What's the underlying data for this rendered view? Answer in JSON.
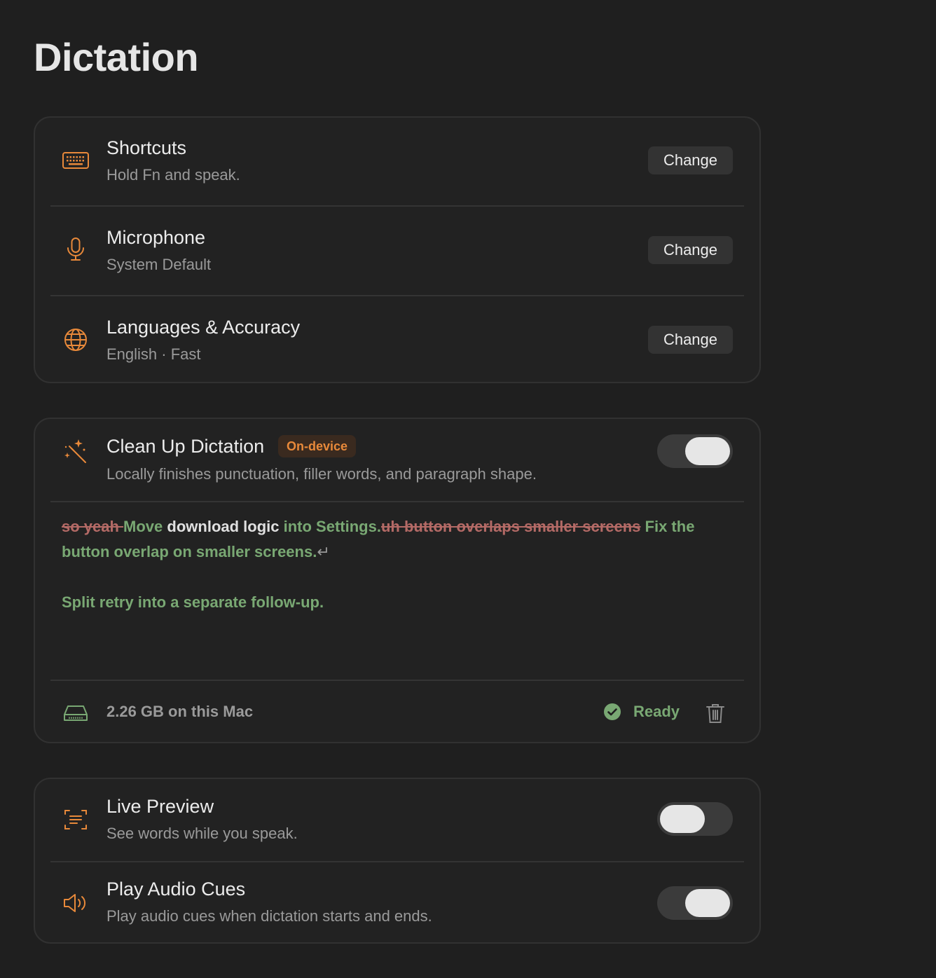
{
  "page": {
    "title": "Dictation"
  },
  "settings": {
    "shortcuts": {
      "title": "Shortcuts",
      "subtitle": "Hold Fn and speak.",
      "action": "Change",
      "icon": "keyboard-icon"
    },
    "microphone": {
      "title": "Microphone",
      "subtitle": "System Default",
      "action": "Change",
      "icon": "microphone-icon"
    },
    "languages": {
      "title": "Languages & Accuracy",
      "subtitle": "English · Fast",
      "action": "Change",
      "icon": "globe-icon"
    }
  },
  "cleanup": {
    "title": "Clean Up Dictation",
    "badge": "On-device",
    "subtitle": "Locally finishes punctuation, filler words, and paragraph shape.",
    "enabled": true,
    "icon": "magic-wand-icon",
    "preview": {
      "line1": [
        {
          "type": "deleted",
          "text": "so yeah "
        },
        {
          "type": "inserted",
          "text": "Move"
        },
        {
          "type": "kept",
          "text": " download logic "
        },
        {
          "type": "inserted",
          "text": "into Settings."
        },
        {
          "type": "deleted",
          "text": "uh button overlaps smaller screens"
        },
        {
          "type": "inserted",
          "text": " Fix the button overlap on smaller screens."
        },
        {
          "type": "return",
          "text": "↵"
        }
      ],
      "line2": [
        {
          "type": "inserted",
          "text": "Split retry into a separate follow-up."
        }
      ]
    },
    "storage": {
      "text": "2.26 GB on this Mac",
      "icon": "hard-drive-icon"
    },
    "status": {
      "text": "Ready",
      "icon": "check-circle-icon"
    },
    "delete_icon": "trash-icon"
  },
  "live_preview": {
    "title": "Live Preview",
    "subtitle": "See words while you speak.",
    "enabled": false,
    "icon": "text-scan-icon"
  },
  "audio_cues": {
    "title": "Play Audio Cues",
    "subtitle": "Play audio cues when dictation starts and ends.",
    "enabled": true,
    "icon": "speaker-icon"
  },
  "colors": {
    "background": "#1f1f1f",
    "card": "#222222",
    "accent": "#e8893a",
    "inserted": "#79a873",
    "deleted": "#b46a66"
  }
}
